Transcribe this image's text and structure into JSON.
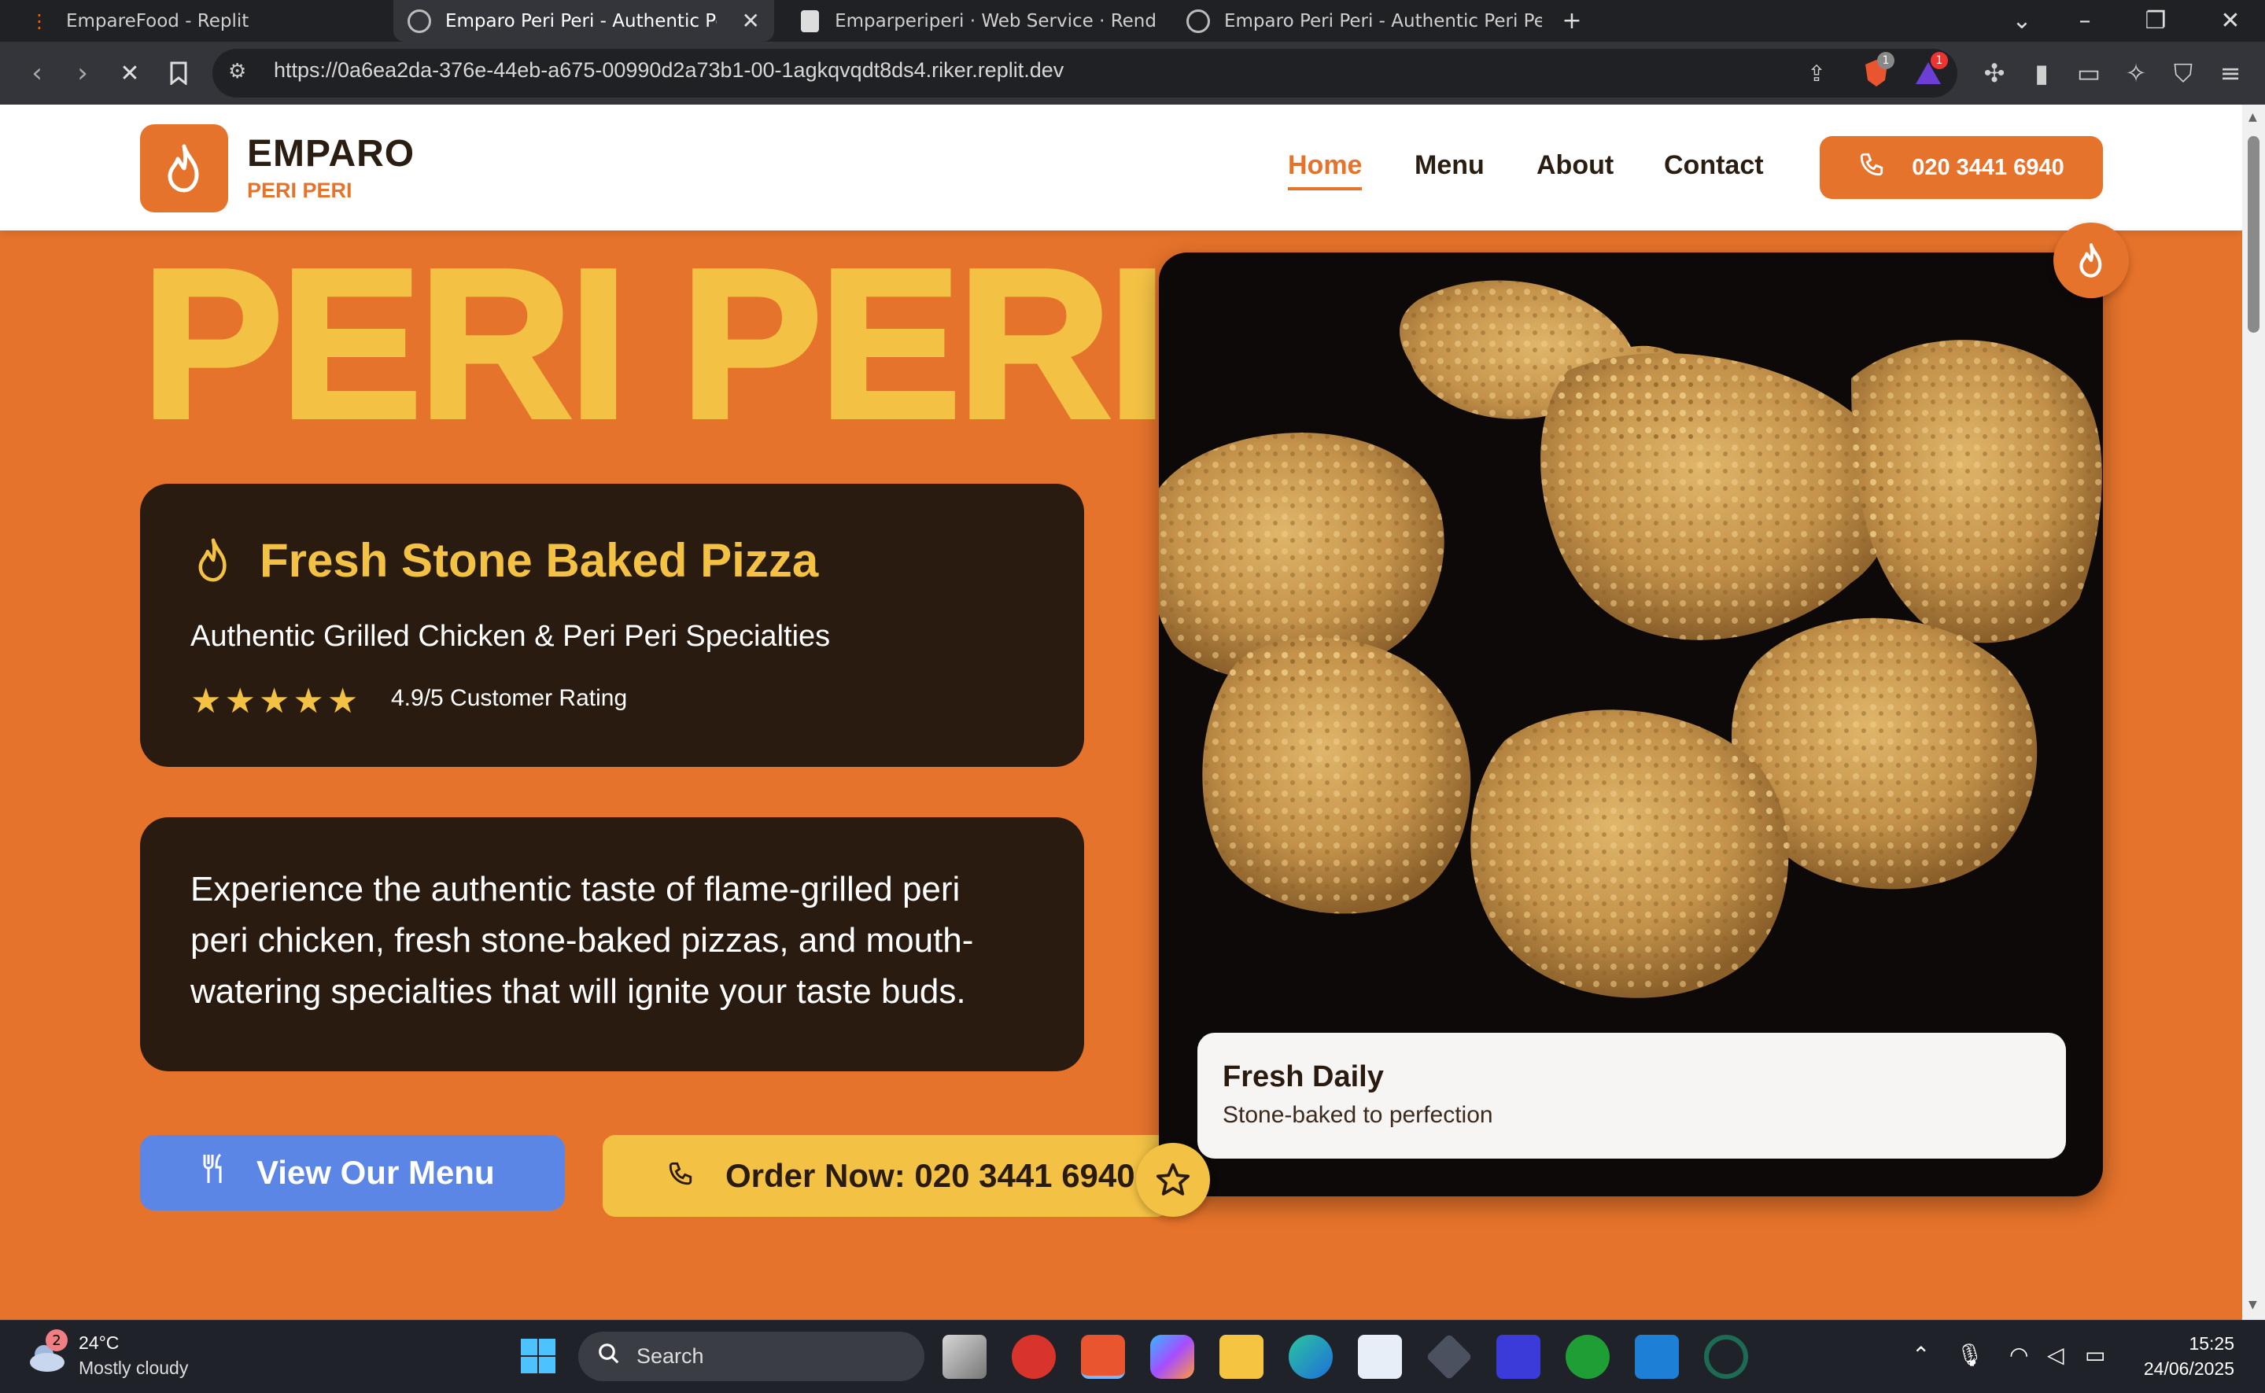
{
  "browser": {
    "tabs": [
      {
        "label": "EmpareFood - Replit"
      },
      {
        "label": "Emparo Peri Peri - Authentic Peri"
      },
      {
        "label": "Emparperiperi · Web Service · Rend"
      },
      {
        "label": "Emparo Peri Peri - Authentic Peri Peri"
      }
    ],
    "new_tab": "+",
    "url": "https://0a6ea2da-376e-44eb-a675-00990d2a73b1-00-1agkqvqdt8ds4.riker.replit.dev",
    "badge_brave": "1",
    "badge_rewards": "1"
  },
  "site": {
    "brand": "EMPARO",
    "brand_sub": "PERI PERI",
    "nav": [
      "Home",
      "Menu",
      "About",
      "Contact"
    ],
    "active_nav": "Home",
    "phone_button": "020 3441 6940",
    "hero_title": "PERI PERI",
    "card1_title": "Fresh Stone Baked Pizza",
    "card1_subtitle": "Authentic Grilled Chicken & Peri Peri Specialties",
    "stars": 5,
    "rating_text": "4.9/5 Customer Rating",
    "description": "Experience the authentic taste of flame-grilled peri peri chicken, fresh stone-baked pizzas, and mouth-watering specialties that will ignite your taste buds.",
    "menu_button": "View Our Menu",
    "order_button": "Order Now: 020 3441 6940",
    "fresh_title": "Fresh Daily",
    "fresh_subtitle": "Stone-baked to perfection"
  },
  "taskbar": {
    "weather_badge": "2",
    "temperature": "24°C",
    "condition": "Mostly cloudy",
    "search_placeholder": "Search",
    "time": "15:25",
    "date": "24/06/2025"
  },
  "colors": {
    "brand_orange": "#e6732b",
    "accent_yellow": "#f3c244",
    "dark_brown": "#2a1b11",
    "menu_blue": "#5b86e6"
  }
}
